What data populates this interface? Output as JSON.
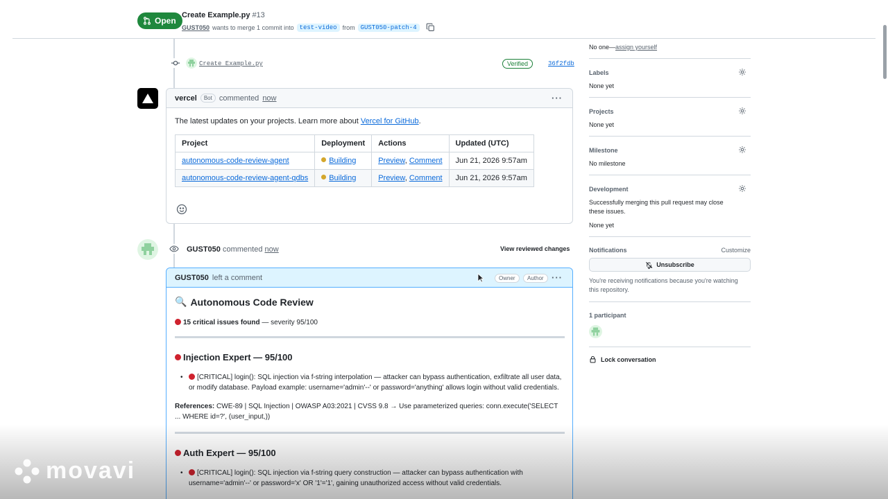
{
  "header": {
    "state": "Open",
    "title": "Create Example.py",
    "number": "#13",
    "author": "GUST050",
    "merge_text": "wants to merge 1 commit into",
    "base_branch": "test-video",
    "from_text": "from",
    "head_branch": "GUST050-patch-4"
  },
  "commit": {
    "message": "Create Example.py",
    "verified": "Verified",
    "sha": "36f2fdb"
  },
  "vercel_comment": {
    "author": "vercel",
    "bot_tag": "Bot",
    "action": "commented",
    "time": "now",
    "intro_text": "The latest updates on your projects. Learn more about",
    "intro_link": "Vercel for GitHub",
    "intro_end": ".",
    "table": {
      "headers": [
        "Project",
        "Deployment",
        "Actions",
        "Updated (UTC)"
      ],
      "rows": [
        {
          "project": "autonomous-code-review-agent",
          "deployment": "Building",
          "preview": "Preview",
          "sep": ",",
          "comment": "Comment",
          "updated": "Jun 21, 2026 9:57am"
        },
        {
          "project": "autonomous-code-review-agent-qdbs",
          "deployment": "Building",
          "preview": "Preview",
          "sep": ",",
          "comment": "Comment",
          "updated": "Jun 21, 2026 9:57am"
        }
      ]
    }
  },
  "review_event": {
    "author": "GUST050",
    "action": "commented",
    "time": "now",
    "view_changes": "View reviewed changes"
  },
  "review_comment": {
    "author": "GUST050",
    "action": "left a comment",
    "owner_tag": "Owner",
    "author_tag": "Author",
    "heading_icon": "🔍",
    "heading": "Autonomous Code Review",
    "summary_bold": "15 critical issues found",
    "summary_rest": "— severity 95/100",
    "sections": [
      {
        "title": "Injection Expert — 95/100",
        "issue": "[CRITICAL] login(): SQL injection via f-string interpolation — attacker can bypass authentication, exfiltrate all user data, or modify database. Payload example: username='admin'--' or password='anything' allows login without valid credentials.",
        "refs_label": "References:",
        "refs": "CWE-89 | SQL Injection | OWASP A03:2021 | CVSS 9.8 → Use parameterized queries: conn.execute('SELECT ... WHERE id=?', (user_input,))"
      },
      {
        "title": "Auth Expert — 95/100",
        "issue": "[CRITICAL] login(): SQL injection via f-string query construction — attacker can bypass authentication with username='admin'--' or password='x' OR '1'='1', gaining unauthorized access without valid credentials."
      }
    ]
  },
  "sidebar": {
    "assignees_value": "No one—",
    "assign_yourself": "assign yourself",
    "labels_title": "Labels",
    "labels_value": "None yet",
    "projects_title": "Projects",
    "projects_value": "None yet",
    "milestone_title": "Milestone",
    "milestone_value": "No milestone",
    "development_title": "Development",
    "development_desc": "Successfully merging this pull request may close these issues.",
    "development_value": "None yet",
    "notifications_title": "Notifications",
    "customize": "Customize",
    "unsubscribe": "Unsubscribe",
    "notifications_desc": "You're receiving notifications because you're watching this repository.",
    "participants": "1 participant",
    "lock": "Lock conversation"
  },
  "watermark": "movavi",
  "colors": {
    "open_green": "#1f883d",
    "link_blue": "#0969da",
    "critical_red": "#cf222e",
    "building_yellow": "#d4a72c",
    "review_highlight": "#ddf4ff"
  },
  "icons": [
    "git-pull-request-icon",
    "copy-icon",
    "git-commit-icon",
    "vercel-logo-icon",
    "kebab-icon",
    "smiley-icon",
    "eye-icon",
    "magnifier-icon",
    "gear-icon",
    "bell-slash-icon",
    "lock-icon",
    "mouse-cursor-icon"
  ]
}
